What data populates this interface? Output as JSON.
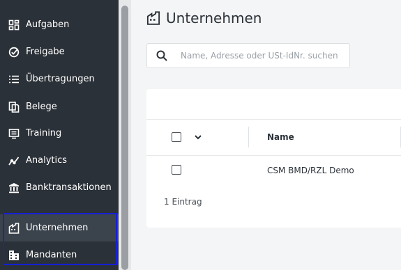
{
  "sidebar": {
    "items": [
      {
        "label": "Aufgaben",
        "icon": "dashboard-icon"
      },
      {
        "label": "Freigabe",
        "icon": "check-circle-icon"
      },
      {
        "label": "Übertragungen",
        "icon": "list-icon"
      },
      {
        "label": "Belege",
        "icon": "documents-icon"
      },
      {
        "label": "Training",
        "icon": "training-icon"
      },
      {
        "label": "Analytics",
        "icon": "analytics-icon"
      },
      {
        "label": "Banktransaktionen",
        "icon": "bank-icon"
      },
      {
        "label": "Unternehmen",
        "icon": "company-icon",
        "active": true
      },
      {
        "label": "Mandanten",
        "icon": "building-icon"
      }
    ]
  },
  "header": {
    "title": "Unternehmen"
  },
  "search": {
    "placeholder": "Name, Adresse oder USt-IdNr. suchen"
  },
  "table": {
    "columns": [
      "Name"
    ],
    "rows": [
      {
        "name": "CSM BMD/RZL Demo"
      }
    ],
    "count_label": "1 Eintrag"
  },
  "colors": {
    "sidebar_bg": "#2b3138",
    "active_item_bg": "#3b434c",
    "highlight_border": "#1420d8",
    "page_bg": "#f4f5f6"
  }
}
